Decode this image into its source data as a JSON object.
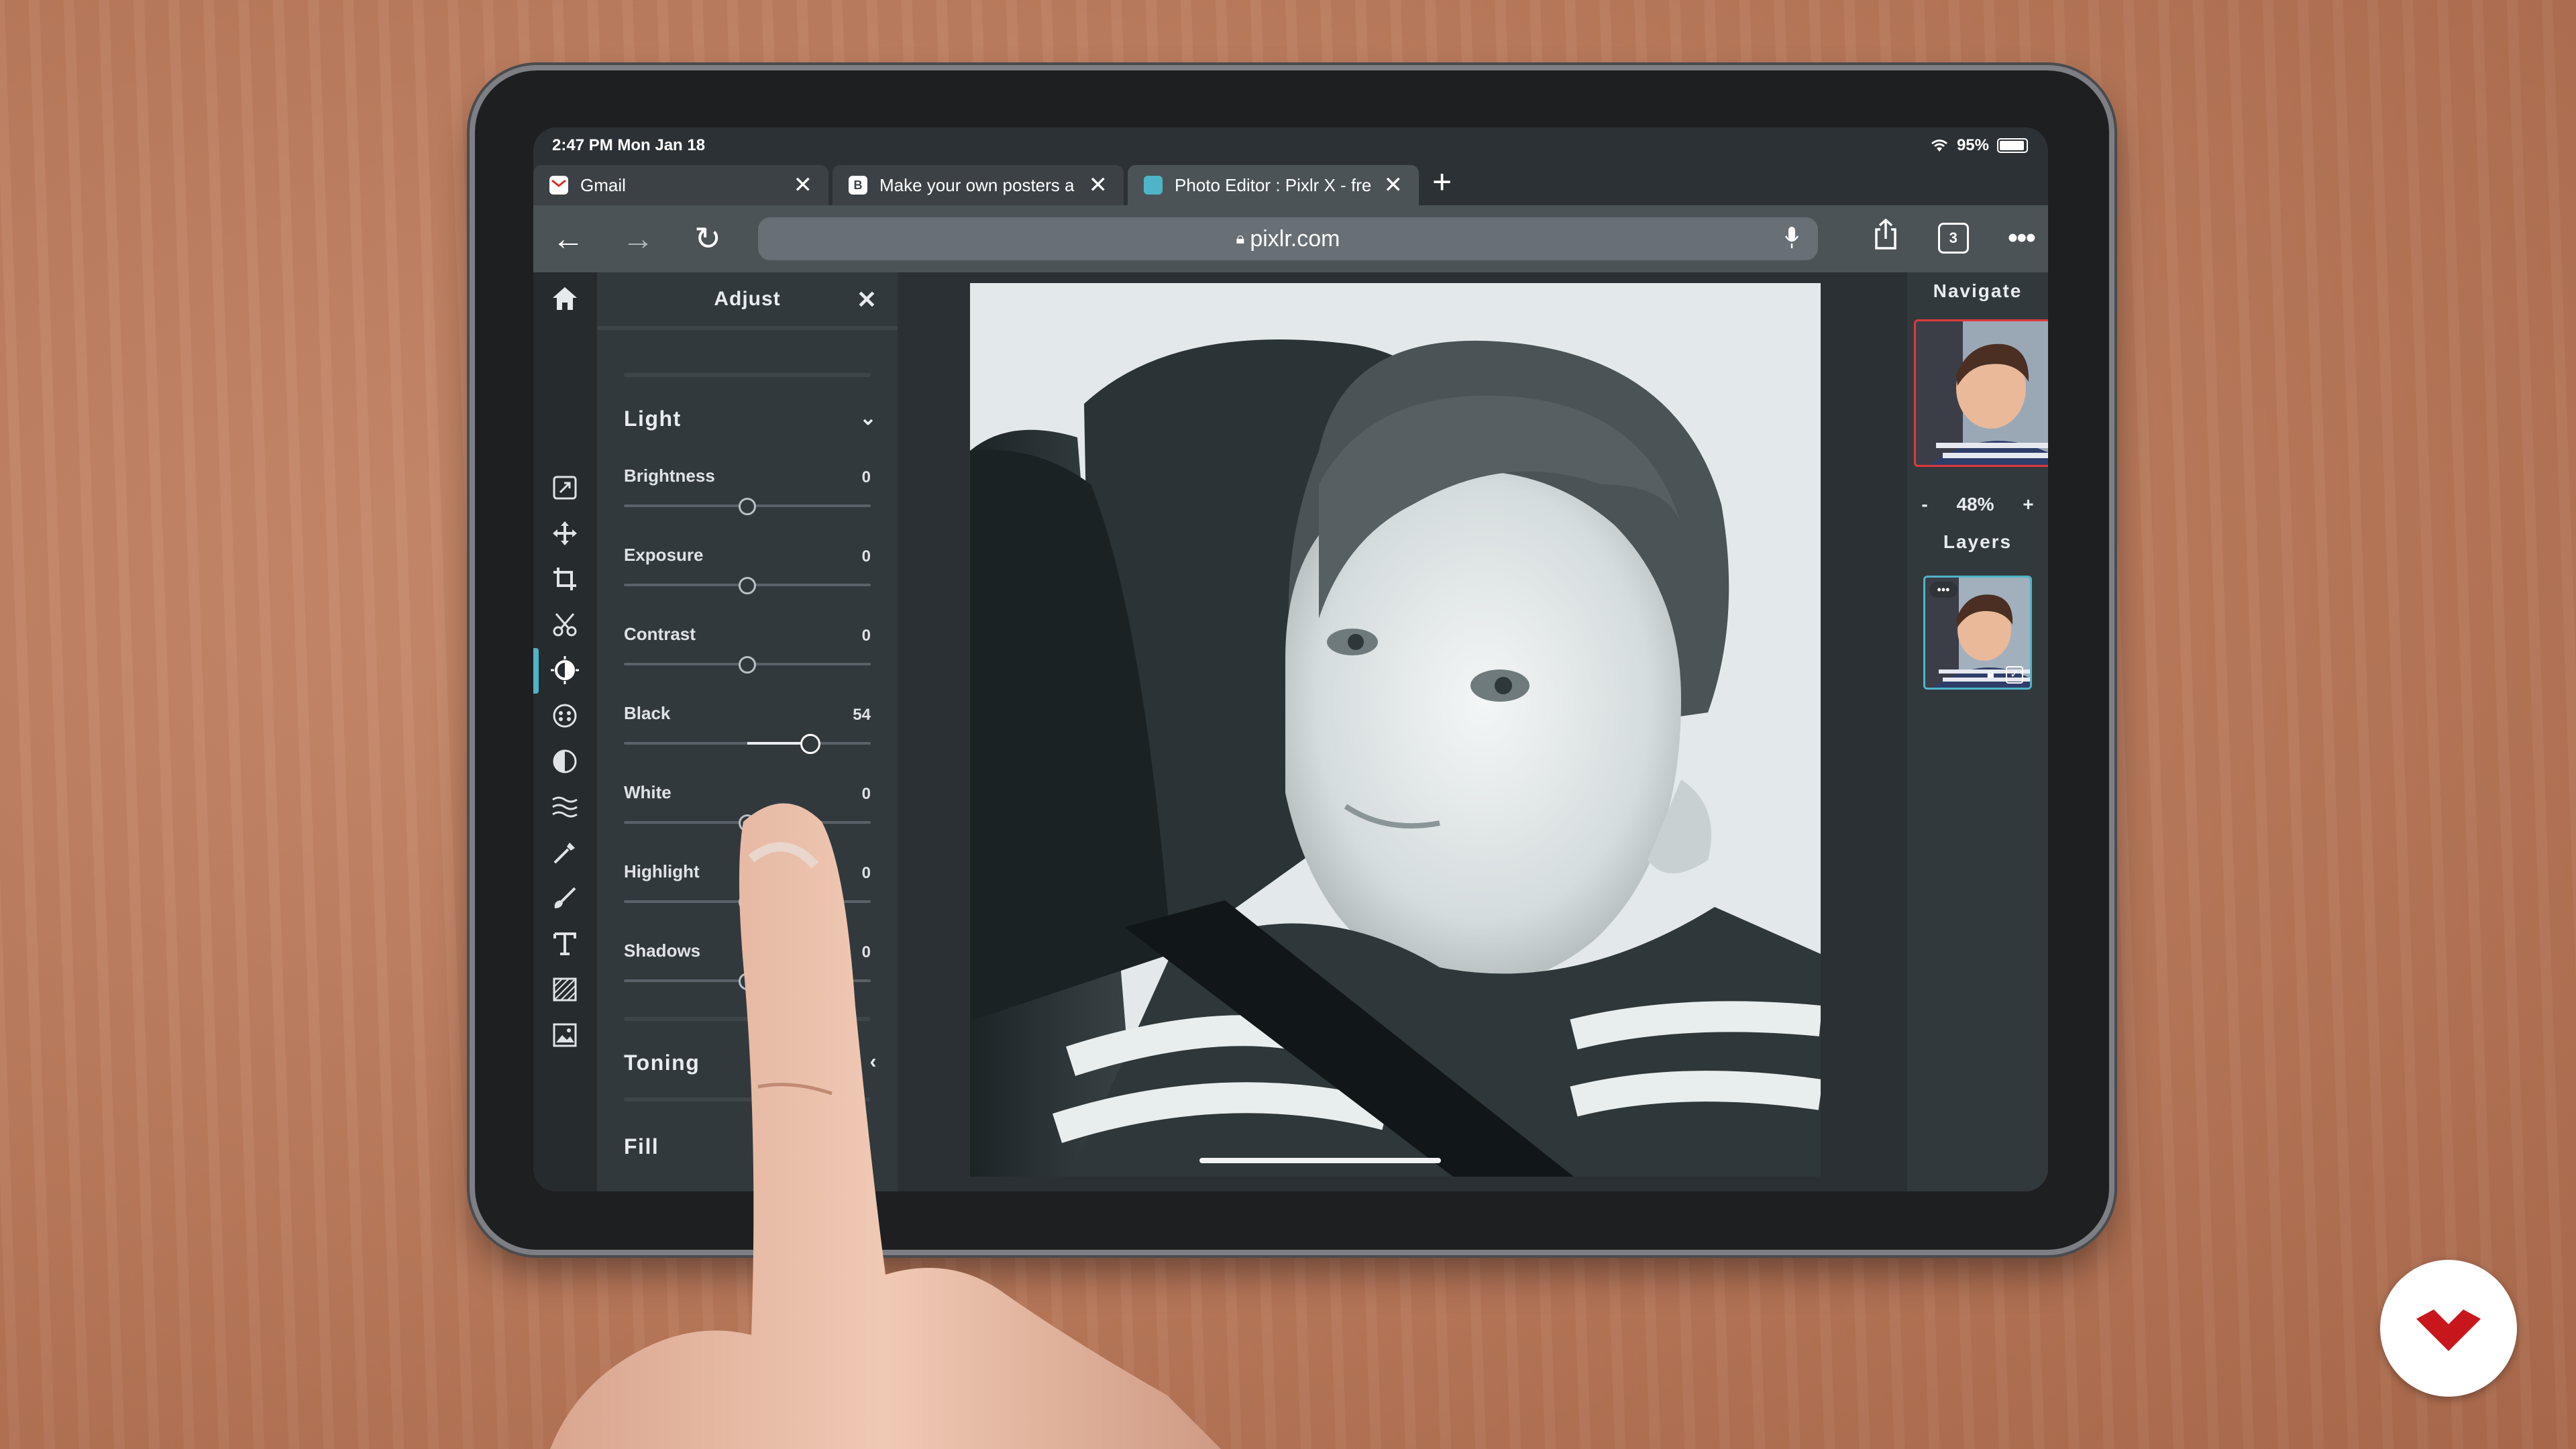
{
  "status": {
    "time_date": "2:47 PM  Mon Jan 18",
    "wifi_icon": "wifi-icon",
    "battery": "95%"
  },
  "tabs": [
    {
      "label": "Gmail",
      "favicon_color": "#d93025",
      "favicon": "gmail-icon"
    },
    {
      "label": "Make your own posters a",
      "favicon_color": "#ffffff",
      "favicon": "B"
    },
    {
      "label": "Photo Editor : Pixlr X - fre",
      "favicon_color": "#4fb4c8",
      "favicon": "pixlr-icon"
    }
  ],
  "toolbar": {
    "url": "pixlr.com",
    "tab_count": "3"
  },
  "panel": {
    "title": "Adjust",
    "section_light": "Light",
    "sliders": [
      {
        "label": "Brightness",
        "value": "0",
        "level": 0.5
      },
      {
        "label": "Exposure",
        "value": "0",
        "level": 0.5
      },
      {
        "label": "Contrast",
        "value": "0",
        "level": 0.5
      },
      {
        "label": "Black",
        "value": "54",
        "level": 0.75
      },
      {
        "label": "White",
        "value": "0",
        "level": 0.5
      },
      {
        "label": "Highlight",
        "value": "0",
        "level": 0.5
      },
      {
        "label": "Shadows",
        "value": "0",
        "level": 0.5
      }
    ],
    "section_toning": "Toning",
    "section_fill": "Fill"
  },
  "rightbar": {
    "navigate": "Navigate",
    "zoom_minus": "-",
    "zoom": "48%",
    "zoom_plus": "+",
    "layers": "Layers"
  },
  "colors": {
    "accent": "#4fb4c8",
    "panel_bg": "#32393d",
    "sidebar_bg": "#262b2e"
  }
}
